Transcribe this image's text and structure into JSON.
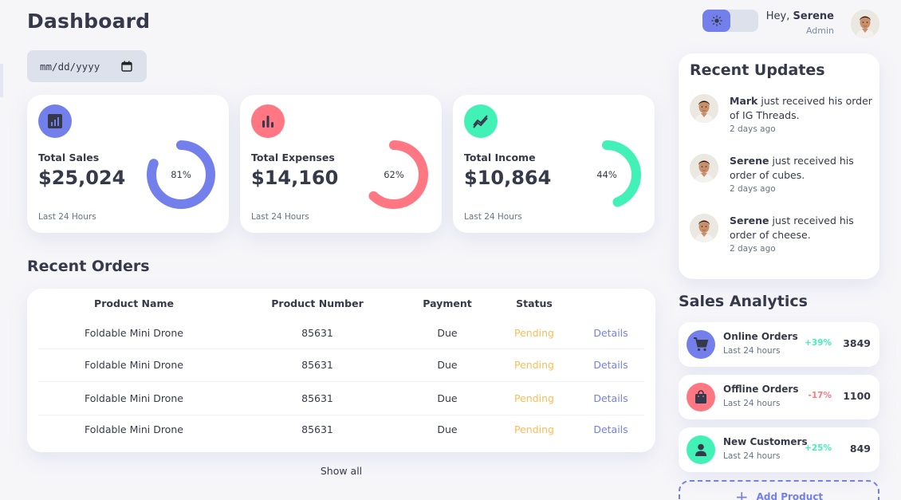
{
  "header": {
    "title": "Dashboard",
    "date_placeholder": "mm/dd/yyyy",
    "greeting_prefix": "Hey,",
    "user_name": "Serene",
    "user_role": "Admin",
    "theme": {
      "active": "light",
      "options": [
        "light-mode-icon",
        "dark-mode-icon"
      ]
    }
  },
  "insights": [
    {
      "label": "Total Sales",
      "amount": "$25,024",
      "percent_text": "81%",
      "percent": 0.81,
      "period": "Last 24 Hours",
      "color": "#7380ec",
      "icon": "analytics-icon"
    },
    {
      "label": "Total Expenses",
      "amount": "$14,160",
      "percent_text": "62%",
      "percent": 0.62,
      "period": "Last 24 Hours",
      "color": "#ff7782",
      "icon": "bar-chart-icon"
    },
    {
      "label": "Total Income",
      "amount": "$10,864",
      "percent_text": "44%",
      "percent": 0.44,
      "period": "Last 24 Hours",
      "color": "#41f1b6",
      "icon": "stocks-icon"
    }
  ],
  "orders": {
    "title": "Recent Orders",
    "columns": [
      "Product Name",
      "Product Number",
      "Payment",
      "Status"
    ],
    "rows": [
      {
        "name": "Foldable Mini Drone",
        "number": "85631",
        "payment": "Due",
        "status": "Pending",
        "action": "Details"
      },
      {
        "name": "Foldable Mini Drone",
        "number": "85631",
        "payment": "Due",
        "status": "Pending",
        "action": "Details"
      },
      {
        "name": "Foldable Mini Drone",
        "number": "85631",
        "payment": "Due",
        "status": "Pending",
        "action": "Details"
      },
      {
        "name": "Foldable Mini Drone",
        "number": "85631",
        "payment": "Due",
        "status": "Pending",
        "action": "Details"
      }
    ],
    "show_all": "Show all"
  },
  "updates": {
    "title": "Recent Updates",
    "items": [
      {
        "name": "Mark",
        "text": "just received his order of IG Threads.",
        "time": "2 days ago"
      },
      {
        "name": "Serene",
        "text": "just received his order of cubes.",
        "time": "2 days ago"
      },
      {
        "name": "Serene",
        "text": "just received his order of cheese.",
        "time": "2 days ago"
      }
    ]
  },
  "analytics": {
    "title": "Sales Analytics",
    "items": [
      {
        "title": "Online Orders",
        "period": "Last 24 hours",
        "change": "+39%",
        "count": "3849",
        "trend": "up",
        "color": "#7380ec",
        "icon": "shopping-cart-icon"
      },
      {
        "title": "Offline Orders",
        "period": "Last 24 hours",
        "change": "-17%",
        "count": "1100",
        "trend": "down",
        "color": "#ff7782",
        "icon": "shopping-bag-icon"
      },
      {
        "title": "New Customers",
        "period": "Last 24 hours",
        "change": "+25%",
        "count": "849",
        "trend": "up",
        "color": "#41f1b6",
        "icon": "person-icon"
      }
    ],
    "add_product": "Add Product"
  },
  "colors": {
    "primary": "#7380ec",
    "danger": "#ff7782",
    "success": "#41f1b6",
    "warning": "#ffbb55",
    "dark": "#363949",
    "background": "#f6f6f9"
  }
}
